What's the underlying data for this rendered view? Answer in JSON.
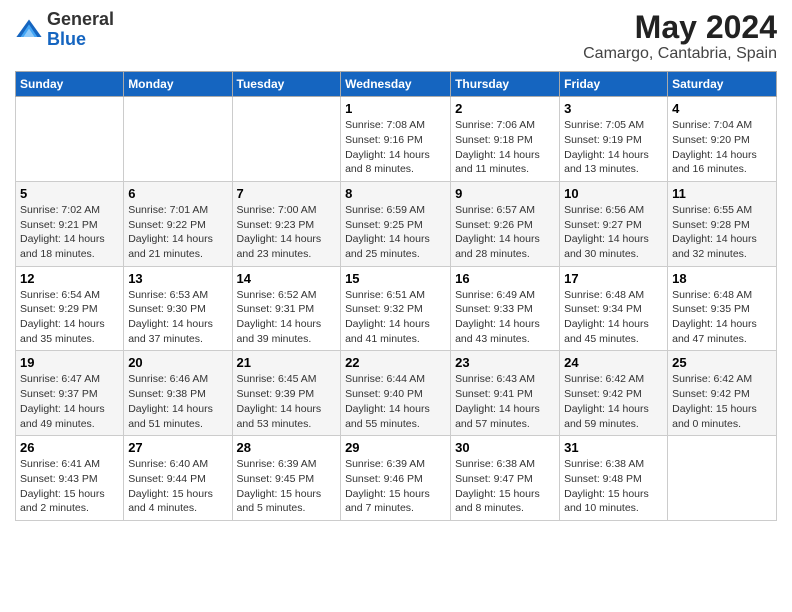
{
  "header": {
    "logo_general": "General",
    "logo_blue": "Blue",
    "month_title": "May 2024",
    "location": "Camargo, Cantabria, Spain"
  },
  "weekdays": [
    "Sunday",
    "Monday",
    "Tuesday",
    "Wednesday",
    "Thursday",
    "Friday",
    "Saturday"
  ],
  "weeks": [
    [
      {
        "day": "",
        "info": ""
      },
      {
        "day": "",
        "info": ""
      },
      {
        "day": "",
        "info": ""
      },
      {
        "day": "1",
        "info": "Sunrise: 7:08 AM\nSunset: 9:16 PM\nDaylight: 14 hours\nand 8 minutes."
      },
      {
        "day": "2",
        "info": "Sunrise: 7:06 AM\nSunset: 9:18 PM\nDaylight: 14 hours\nand 11 minutes."
      },
      {
        "day": "3",
        "info": "Sunrise: 7:05 AM\nSunset: 9:19 PM\nDaylight: 14 hours\nand 13 minutes."
      },
      {
        "day": "4",
        "info": "Sunrise: 7:04 AM\nSunset: 9:20 PM\nDaylight: 14 hours\nand 16 minutes."
      }
    ],
    [
      {
        "day": "5",
        "info": "Sunrise: 7:02 AM\nSunset: 9:21 PM\nDaylight: 14 hours\nand 18 minutes."
      },
      {
        "day": "6",
        "info": "Sunrise: 7:01 AM\nSunset: 9:22 PM\nDaylight: 14 hours\nand 21 minutes."
      },
      {
        "day": "7",
        "info": "Sunrise: 7:00 AM\nSunset: 9:23 PM\nDaylight: 14 hours\nand 23 minutes."
      },
      {
        "day": "8",
        "info": "Sunrise: 6:59 AM\nSunset: 9:25 PM\nDaylight: 14 hours\nand 25 minutes."
      },
      {
        "day": "9",
        "info": "Sunrise: 6:57 AM\nSunset: 9:26 PM\nDaylight: 14 hours\nand 28 minutes."
      },
      {
        "day": "10",
        "info": "Sunrise: 6:56 AM\nSunset: 9:27 PM\nDaylight: 14 hours\nand 30 minutes."
      },
      {
        "day": "11",
        "info": "Sunrise: 6:55 AM\nSunset: 9:28 PM\nDaylight: 14 hours\nand 32 minutes."
      }
    ],
    [
      {
        "day": "12",
        "info": "Sunrise: 6:54 AM\nSunset: 9:29 PM\nDaylight: 14 hours\nand 35 minutes."
      },
      {
        "day": "13",
        "info": "Sunrise: 6:53 AM\nSunset: 9:30 PM\nDaylight: 14 hours\nand 37 minutes."
      },
      {
        "day": "14",
        "info": "Sunrise: 6:52 AM\nSunset: 9:31 PM\nDaylight: 14 hours\nand 39 minutes."
      },
      {
        "day": "15",
        "info": "Sunrise: 6:51 AM\nSunset: 9:32 PM\nDaylight: 14 hours\nand 41 minutes."
      },
      {
        "day": "16",
        "info": "Sunrise: 6:49 AM\nSunset: 9:33 PM\nDaylight: 14 hours\nand 43 minutes."
      },
      {
        "day": "17",
        "info": "Sunrise: 6:48 AM\nSunset: 9:34 PM\nDaylight: 14 hours\nand 45 minutes."
      },
      {
        "day": "18",
        "info": "Sunrise: 6:48 AM\nSunset: 9:35 PM\nDaylight: 14 hours\nand 47 minutes."
      }
    ],
    [
      {
        "day": "19",
        "info": "Sunrise: 6:47 AM\nSunset: 9:37 PM\nDaylight: 14 hours\nand 49 minutes."
      },
      {
        "day": "20",
        "info": "Sunrise: 6:46 AM\nSunset: 9:38 PM\nDaylight: 14 hours\nand 51 minutes."
      },
      {
        "day": "21",
        "info": "Sunrise: 6:45 AM\nSunset: 9:39 PM\nDaylight: 14 hours\nand 53 minutes."
      },
      {
        "day": "22",
        "info": "Sunrise: 6:44 AM\nSunset: 9:40 PM\nDaylight: 14 hours\nand 55 minutes."
      },
      {
        "day": "23",
        "info": "Sunrise: 6:43 AM\nSunset: 9:41 PM\nDaylight: 14 hours\nand 57 minutes."
      },
      {
        "day": "24",
        "info": "Sunrise: 6:42 AM\nSunset: 9:42 PM\nDaylight: 14 hours\nand 59 minutes."
      },
      {
        "day": "25",
        "info": "Sunrise: 6:42 AM\nSunset: 9:42 PM\nDaylight: 15 hours\nand 0 minutes."
      }
    ],
    [
      {
        "day": "26",
        "info": "Sunrise: 6:41 AM\nSunset: 9:43 PM\nDaylight: 15 hours\nand 2 minutes."
      },
      {
        "day": "27",
        "info": "Sunrise: 6:40 AM\nSunset: 9:44 PM\nDaylight: 15 hours\nand 4 minutes."
      },
      {
        "day": "28",
        "info": "Sunrise: 6:39 AM\nSunset: 9:45 PM\nDaylight: 15 hours\nand 5 minutes."
      },
      {
        "day": "29",
        "info": "Sunrise: 6:39 AM\nSunset: 9:46 PM\nDaylight: 15 hours\nand 7 minutes."
      },
      {
        "day": "30",
        "info": "Sunrise: 6:38 AM\nSunset: 9:47 PM\nDaylight: 15 hours\nand 8 minutes."
      },
      {
        "day": "31",
        "info": "Sunrise: 6:38 AM\nSunset: 9:48 PM\nDaylight: 15 hours\nand 10 minutes."
      },
      {
        "day": "",
        "info": ""
      }
    ]
  ]
}
